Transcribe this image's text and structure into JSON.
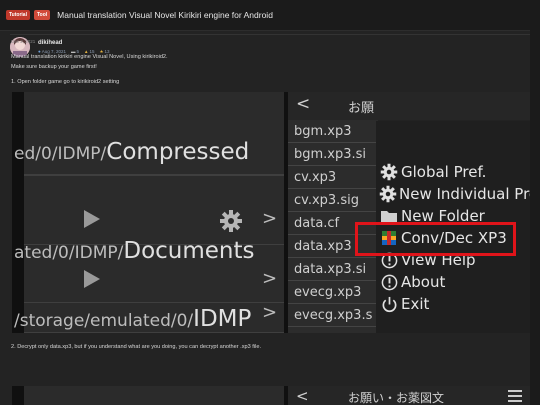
{
  "thread": {
    "prefix_tutorial": "Tutorial",
    "prefix_tool": "Tool",
    "title": "Manual translation Visual Novel Kirikiri engine for Android"
  },
  "author": {
    "name": "dikihead",
    "joined": "Aug 7, 2021",
    "messages": "5",
    "reactions": "15",
    "points": "13"
  },
  "post": {
    "date": "Dec 2, 2021",
    "line1": "Manual translation kirikiri engine Visual Novel, Using kirikiroid2.",
    "line2": "Make sure backup your game first!",
    "step1": "1. Open folder game go to kirikiroid2 setting",
    "step2": "2. Decrypt only data.xp3, but if you understand what are you doing, you can decrypt another .xp3 file."
  },
  "screenshot": {
    "left_rows": [
      {
        "dim": "ed/0/IDMP/",
        "big": "Compressed"
      },
      {
        "dim": "ated/0/IDMP/",
        "big": "Documents"
      },
      {
        "dim": "/storage/emulated/0/",
        "big": "IDMP"
      }
    ],
    "header_back": "<",
    "header_title": "お願",
    "files": [
      "bgm.xp3",
      "bgm.xp3.si",
      "cv.xp3",
      "cv.xp3.sig",
      "data.cf",
      "data.xp3",
      "data.xp3.si",
      "evecg.xp3",
      "evecg.xp3.s"
    ],
    "menu": [
      {
        "icon": "gear-icon",
        "label": "Global Pref."
      },
      {
        "icon": "gear-icon",
        "label": "New Individual Pre"
      },
      {
        "icon": "folder-icon",
        "label": "New Folder"
      },
      {
        "icon": "package-icon",
        "label": "Conv/Dec XP3"
      },
      {
        "icon": "info-icon",
        "label": "View Help"
      },
      {
        "icon": "info-icon",
        "label": "About"
      },
      {
        "icon": "power-icon",
        "label": "Exit"
      }
    ],
    "highlight_color": "#e0141a"
  },
  "screenshot2": {
    "header_back": "<",
    "header_title": "お願い・お薬図文"
  }
}
